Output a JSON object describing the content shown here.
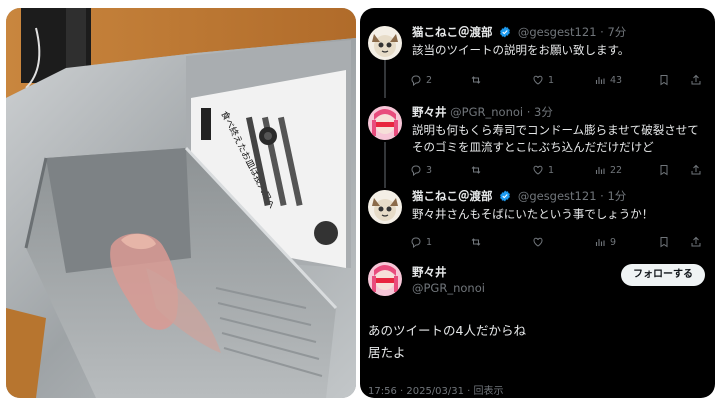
{
  "colors": {
    "background": "#000000",
    "text": "#e7e9ea",
    "muted": "#71767b",
    "verified": "#1d9bf0",
    "follow_button_bg": "#eff3f4"
  },
  "photo": {
    "sign_text": "食べ終えたお皿は投入口へ"
  },
  "tweets": [
    {
      "name": "猫こねこ＠渡部",
      "verified": true,
      "handle": "@gesgest121",
      "time": "· 7分",
      "text": "該当のツイートの説明をお願い致します。",
      "replies": "2",
      "retweets": "",
      "likes": "1",
      "views": "43"
    },
    {
      "name": "野々井",
      "verified": false,
      "handle": "@PGR_nonoi",
      "time": "· 3分",
      "text": "説明も何もくら寿司でコンドーム膨らませて破裂させてそのゴミを皿流すとこにぶち込んだだけだけど",
      "replies": "3",
      "retweets": "",
      "likes": "1",
      "views": "22"
    },
    {
      "name": "猫こねこ＠渡部",
      "verified": true,
      "handle": "@gesgest121",
      "time": "· 1分",
      "text": "野々井さんもそばにいたという事でしょうか！",
      "replies": "1",
      "retweets": "",
      "likes": "",
      "views": "9"
    }
  ],
  "main_tweet": {
    "name": "野々井",
    "handle": "@PGR_nonoi",
    "follow_label": "フォローする",
    "text_line1": "あのツイートの4人だからね",
    "text_line2": "居たよ",
    "timestamp": "17:56 · 2025/03/31 · 回表示"
  },
  "icons": [
    "reply-icon",
    "retweet-icon",
    "like-icon",
    "views-icon",
    "bookmark-icon",
    "share-icon",
    "verified-icon"
  ]
}
